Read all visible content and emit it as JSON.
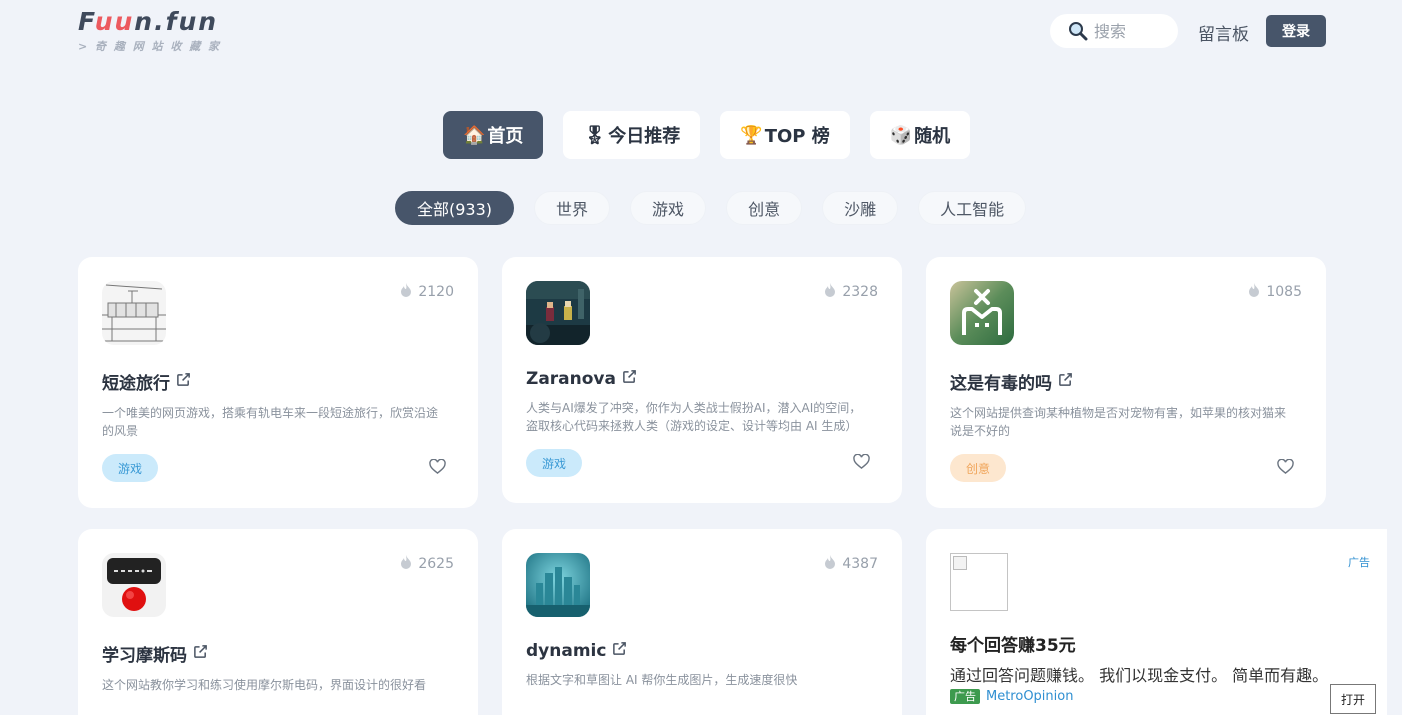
{
  "header": {
    "logo_parts": [
      "F",
      "uu",
      "n",
      ".fun"
    ],
    "logo_sub": "> 奇 趣 网 站 收 藏 家",
    "search_placeholder": "搜索",
    "guestbook_label": "留言板",
    "login_label": "登录"
  },
  "nav": [
    {
      "icon": "🏠",
      "label": "首页",
      "active": true
    },
    {
      "icon": "🎖",
      "label": "今日推荐",
      "active": false
    },
    {
      "icon": "🏆",
      "label": "TOP 榜",
      "active": false
    },
    {
      "icon": "🎲",
      "label": "随机",
      "active": false
    }
  ],
  "chips": [
    {
      "label": "全部(933)",
      "active": true
    },
    {
      "label": "世界",
      "active": false
    },
    {
      "label": "游戏",
      "active": false
    },
    {
      "label": "创意",
      "active": false
    },
    {
      "label": "沙雕",
      "active": false
    },
    {
      "label": "人工智能",
      "active": false
    }
  ],
  "cards": [
    {
      "title": "短途旅行",
      "hot": "2120",
      "desc": "一个唯美的网页游戏，搭乘有轨电车来一段短途旅行，欣赏沿途的风景",
      "tag": "游戏",
      "tag_type": "game",
      "thumb": "tram-sketch"
    },
    {
      "title": "Zaranova",
      "hot": "2328",
      "desc": "人类与AI爆发了冲突，你作为人类战士假扮AI，潜入AI的空间，盗取核心代码来拯救人类（游戏的设定、设计等均由 AI 生成）",
      "tag": "游戏",
      "tag_type": "game",
      "thumb": "pixel-game"
    },
    {
      "title": "这是有毒的吗",
      "hot": "1085",
      "desc": "这个网站提供查询某种植物是否对宠物有害，如苹果的核对猫来说是不好的",
      "tag": "创意",
      "tag_type": "creative",
      "thumb": "cat-x"
    },
    {
      "title": "学习摩斯码",
      "hot": "2625",
      "desc": "这个网站教你学习和练习使用摩尔斯电码，界面设计的很好看",
      "thumb": "morse"
    },
    {
      "title": "dynamic",
      "hot": "4387",
      "desc": "根据文字和草图让 AI 帮你生成图片，生成速度很快",
      "thumb": "city"
    }
  ],
  "ad": {
    "corner_label": "广告",
    "title": "每个回答赚35元",
    "text": "通过回答问题赚钱。 我们以现金支付。 简单而有趣。",
    "badge": "广告",
    "source": "MetroOpinion",
    "open_label": "打开"
  },
  "colors": {
    "background": "#f0f3f9",
    "accent_dark": "#47556a",
    "logo_red": "#ec5a5f",
    "tag_game_bg": "#cbeafb",
    "tag_creative_bg": "#fde7cf"
  }
}
